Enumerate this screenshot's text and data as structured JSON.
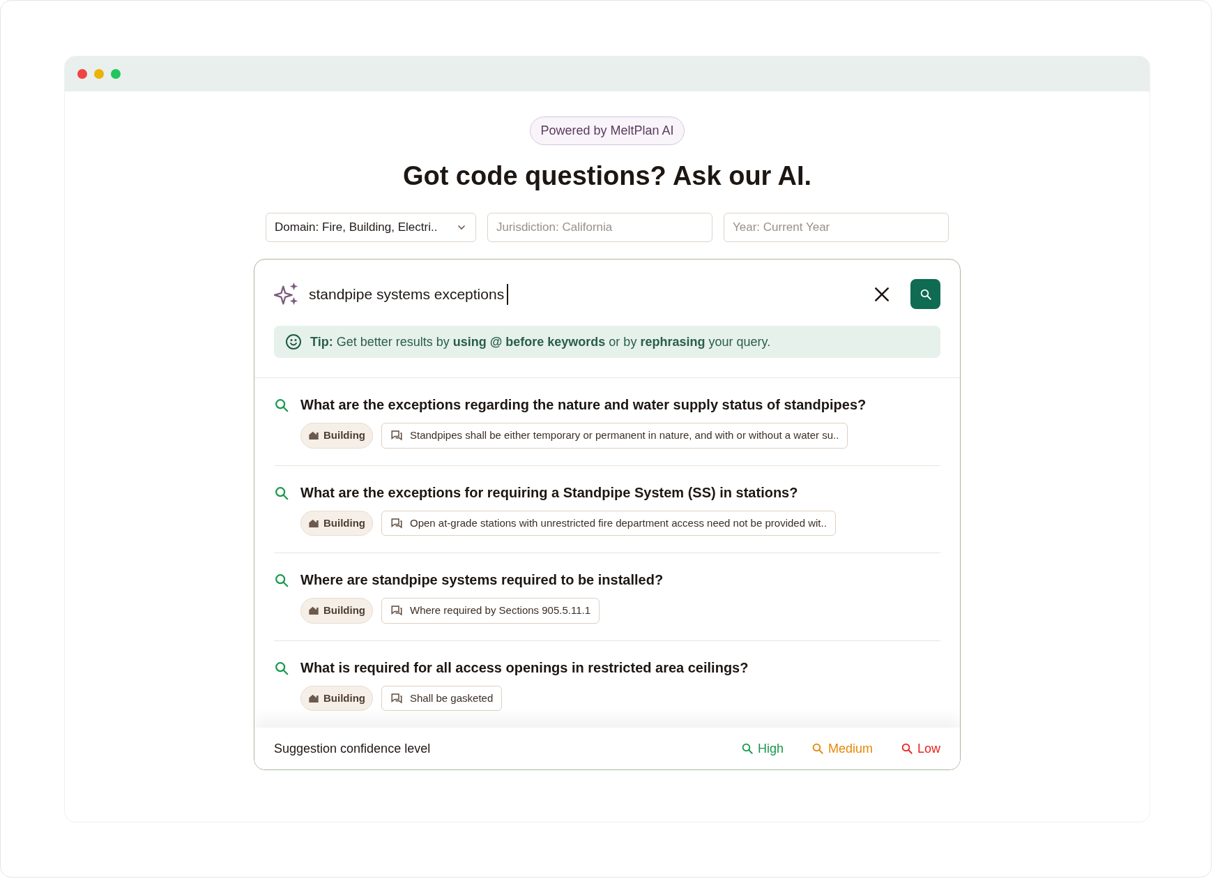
{
  "badge": "Powered by MeltPlan AI",
  "heading": "Got code questions? Ask our AI.",
  "filters": [
    {
      "kind": "dropdown",
      "value": "Domain: Fire, Building, Electri.."
    },
    {
      "kind": "text",
      "placeholder": "Jurisdiction: California"
    },
    {
      "kind": "text",
      "placeholder": "Year: Current Year"
    }
  ],
  "search": {
    "value": "standpipe systems exceptions"
  },
  "tip": "**Tip:** Get better results by **using @ before keywords** or by **rephrasing** your query.",
  "results": [
    {
      "kind": "high",
      "question": "What are the exceptions regarding the nature and water supply status of standpipes?",
      "tag": "Building",
      "excerpt": "Standpipes shall be either temporary or permanent in nature, and with or without a water su.."
    },
    {
      "kind": "high",
      "question": "What are the exceptions for requiring a Standpipe System (SS) in stations?",
      "tag": "Building",
      "excerpt": "Open at-grade stations with unrestricted fire department access need not be provided wit.."
    },
    {
      "kind": "high",
      "question": "Where are standpipe systems required to be installed?",
      "tag": "Building",
      "excerpt": "Where required by Sections 905.5.11.1"
    },
    {
      "kind": "high",
      "question": "What is required for all access openings in restricted area ceilings?",
      "tag": "Building",
      "excerpt": "Shall be gasketed"
    }
  ],
  "legend": {
    "title": "Suggestion confidence level",
    "levels": [
      {
        "label": "High",
        "color": "#17994a"
      },
      {
        "label": "Medium",
        "color": "#e5890a"
      },
      {
        "label": "Low",
        "color": "#e8221c"
      }
    ]
  }
}
